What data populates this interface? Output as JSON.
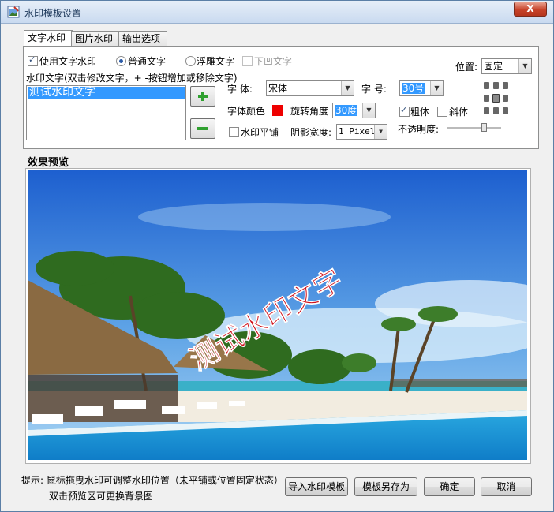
{
  "window": {
    "title": "水印模板设置",
    "close_label": "X"
  },
  "tabs": [
    {
      "label": "文字水印"
    },
    {
      "label": "图片水印"
    },
    {
      "label": "输出选项"
    }
  ],
  "text_tab": {
    "use_text_watermark": {
      "label": "使用文字水印",
      "checked": true
    },
    "style_normal": {
      "label": "普通文字",
      "checked": true
    },
    "style_emboss": {
      "label": "浮雕文字",
      "checked": false
    },
    "style_engrave": {
      "label": "下凹文字",
      "checked": false,
      "disabled": true
    },
    "list_label": "水印文字(双击修改文字，+ -按钮增加或移除文字)",
    "list_items": [
      "测试水印文字"
    ],
    "add_icon": "plus-icon",
    "remove_icon": "minus-icon",
    "font_label": "字 体:",
    "font_value": "宋体",
    "size_label": "字 号:",
    "size_value": "30号",
    "color_label": "字体颜色",
    "font_color": "#ee0000",
    "rotate_label": "旋转角度",
    "rotate_value": "30度",
    "bold": {
      "label": "粗体",
      "checked": true
    },
    "italic": {
      "label": "斜体",
      "checked": false
    },
    "tile": {
      "label": "水印平铺",
      "checked": false
    },
    "shadow_label": "阴影宽度:",
    "shadow_value": "1 Pixel",
    "position_label": "位置:",
    "position_value": "固定",
    "opacity_label": "不透明度:"
  },
  "preview": {
    "label": "效果预览",
    "watermark_text": "测试水印文字",
    "watermark_color": "#d0101a"
  },
  "hints": {
    "line1": "提示: 鼠标拖曳水印可调整水印位置（未平铺或位置固定状态）",
    "line2": "双击预览区可更换背景图"
  },
  "buttons": {
    "import": "导入水印模板",
    "save_as": "模板另存为",
    "ok": "确定",
    "cancel": "取消"
  }
}
